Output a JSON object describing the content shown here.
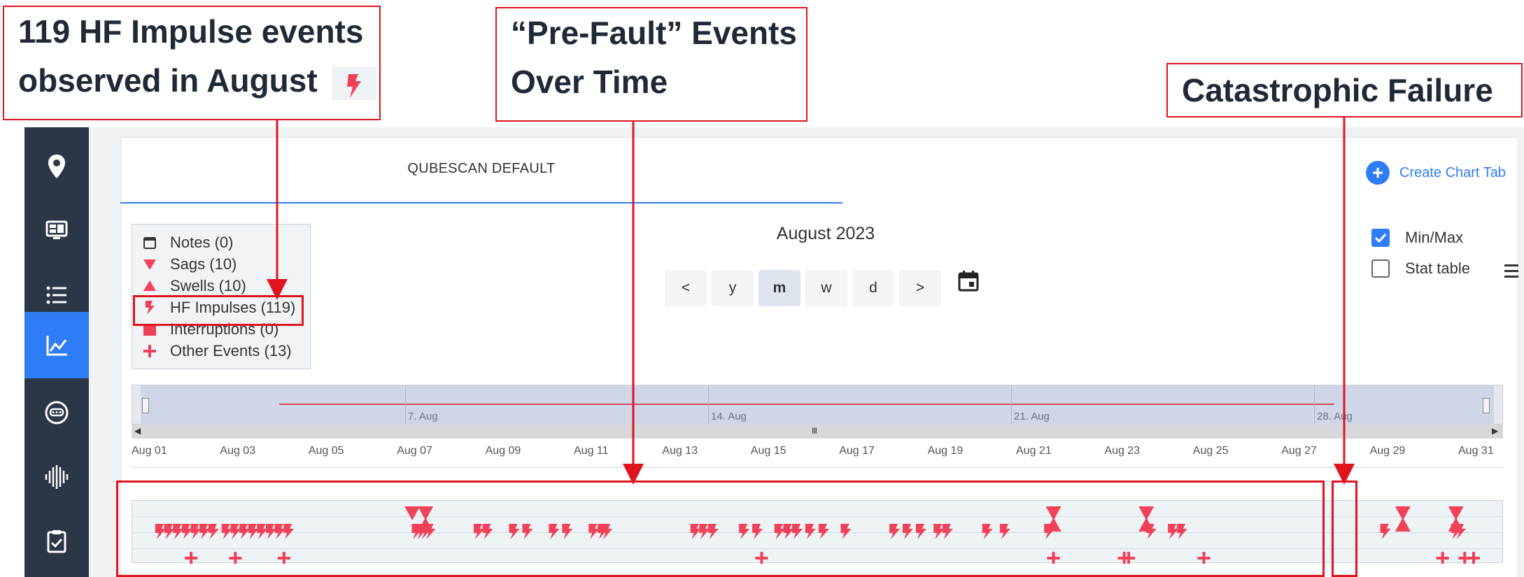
{
  "annotations": {
    "hf_callout_line1": "119 HF Impulse events",
    "hf_callout_line2": "observed in August",
    "prefault_line1": "“Pre-Fault” Events",
    "prefault_line2": "Over Time",
    "catastrophic": "Catastrophic Failure"
  },
  "sidebar": {
    "items": [
      {
        "icon": "map-pin-icon"
      },
      {
        "icon": "dashboard-icon"
      },
      {
        "icon": "list-icon"
      },
      {
        "icon": "chart-icon",
        "active": true
      },
      {
        "icon": "meter-icon"
      },
      {
        "icon": "waveform-icon"
      },
      {
        "icon": "clipboard-check-icon"
      }
    ]
  },
  "tabs": {
    "active": "QUBESCAN DEFAULT",
    "create_label": "Create Chart Tab"
  },
  "legend": {
    "items": [
      {
        "symbol": "calendar-icon",
        "label": "Notes (0)"
      },
      {
        "symbol": "triangle-down",
        "label": "Sags (10)"
      },
      {
        "symbol": "triangle-up",
        "label": "Swells (10)"
      },
      {
        "symbol": "bolt",
        "label": "HF Impulses (119)"
      },
      {
        "symbol": "square",
        "label": "Interruptions (0)"
      },
      {
        "symbol": "plus",
        "label": "Other Events (13)"
      }
    ]
  },
  "period": {
    "title": "August 2023",
    "buttons": [
      "<",
      "y",
      "m",
      "w",
      "d",
      ">"
    ],
    "selected": "m"
  },
  "options": {
    "minmax_label": "Min/Max",
    "minmax_checked": true,
    "stat_label": "Stat table",
    "stat_checked": false
  },
  "navigator": {
    "dates": [
      "7. Aug",
      "14. Aug",
      "21. Aug",
      "28. Aug"
    ],
    "grip": "III"
  },
  "axis": {
    "labels": [
      "Aug 01",
      "Aug 03",
      "Aug 05",
      "Aug 07",
      "Aug 09",
      "Aug 11",
      "Aug 13",
      "Aug 15",
      "Aug 17",
      "Aug 19",
      "Aug 21",
      "Aug 23",
      "Aug 25",
      "Aug 27",
      "Aug 29",
      "Aug 31"
    ]
  },
  "events": {
    "day_range": [
      1,
      31.5
    ],
    "sags": [
      7.3,
      7.6,
      21.8,
      23.9,
      29.7,
      30.9
    ],
    "swells": [
      7.6,
      21.8,
      23.9,
      29.7,
      30.9
    ],
    "impulses": [
      1.6,
      1.8,
      2.0,
      2.2,
      2.4,
      2.6,
      2.8,
      3.1,
      3.3,
      3.5,
      3.7,
      3.9,
      4.1,
      4.3,
      4.5,
      7.4,
      7.5,
      7.6,
      7.7,
      8.8,
      9.0,
      9.6,
      9.9,
      10.5,
      10.8,
      11.4,
      11.6,
      11.7,
      13.7,
      13.9,
      14.1,
      14.8,
      15.1,
      15.6,
      15.8,
      16.0,
      16.3,
      16.6,
      17.1,
      18.2,
      18.5,
      18.8,
      19.2,
      19.4,
      20.3,
      20.7,
      21.7,
      24.0,
      24.5,
      24.7,
      29.3,
      30.9,
      31.0
    ],
    "other": [
      2.3,
      3.3,
      4.4,
      15.2,
      21.8,
      23.4,
      23.5,
      25.2,
      30.6,
      31.1,
      31.3
    ]
  },
  "colors": {
    "accent": "#2f7df6",
    "event": "#f0415a",
    "annotation": "#e0141e",
    "sidebar": "#2b3647"
  }
}
